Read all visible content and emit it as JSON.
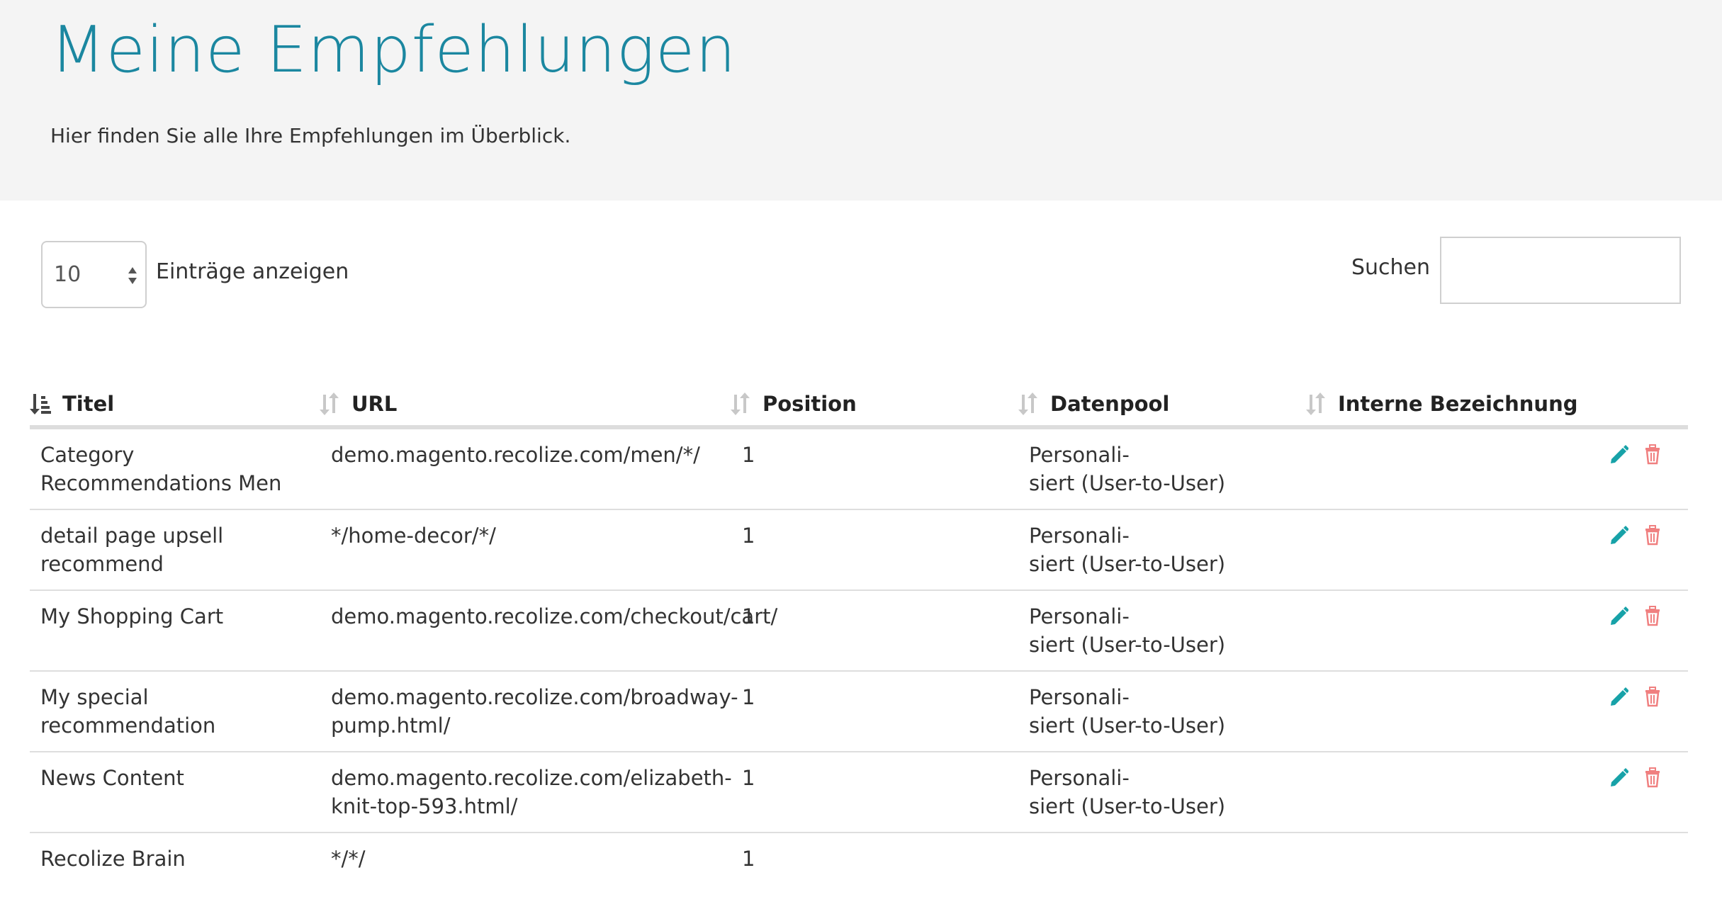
{
  "header": {
    "title": "Meine Empfehlungen",
    "subtitle": "Hier finden Sie alle Ihre Empfehlungen im Überblick."
  },
  "controls": {
    "length_value": "10",
    "length_label": "Einträge anzeigen",
    "search_label": "Suchen",
    "search_value": ""
  },
  "table": {
    "columns": [
      "Titel",
      "URL",
      "Position",
      "Datenpool",
      "Interne Bezeichnung"
    ],
    "rows": [
      {
        "title": "Category Recommendations Men",
        "url": "demo.magento.recolize.com/men/*/",
        "position": "1",
        "pool": "Personali-\nsiert (User-to-User)",
        "internal": "",
        "actions": true
      },
      {
        "title": "detail page upsell recommend",
        "url": "*/home-decor/*/",
        "position": "1",
        "pool": "Personali-\nsiert (User-to-User)",
        "internal": "",
        "actions": true
      },
      {
        "title": "My Shopping Cart",
        "url": "demo.magento.recolize.com/checkout/cart/",
        "position": "1",
        "pool": "Personali-\nsiert (User-to-User)",
        "internal": "",
        "actions": true
      },
      {
        "title": "My special recommendation",
        "url": "demo.magento.recolize.com/broadway-pump.html/",
        "position": "1",
        "pool": "Personali-\nsiert (User-to-User)",
        "internal": "",
        "actions": true
      },
      {
        "title": "News Content",
        "url": "demo.magento.recolize.com/elizabeth-knit-top-593.html/",
        "position": "1",
        "pool": "Personali-\nsiert (User-to-User)",
        "internal": "",
        "actions": true
      },
      {
        "title": "Recolize Brain",
        "url": "*/*/",
        "position": "1",
        "pool": "",
        "internal": "",
        "actions": false
      }
    ]
  },
  "icons": {
    "edit": "pencil-icon",
    "delete": "trash-icon",
    "sort_active": "sort-asc-icon",
    "sort": "sort-icon"
  },
  "colors": {
    "title": "#1b87a0",
    "edit": "#17a2a8",
    "delete": "#f08080"
  }
}
